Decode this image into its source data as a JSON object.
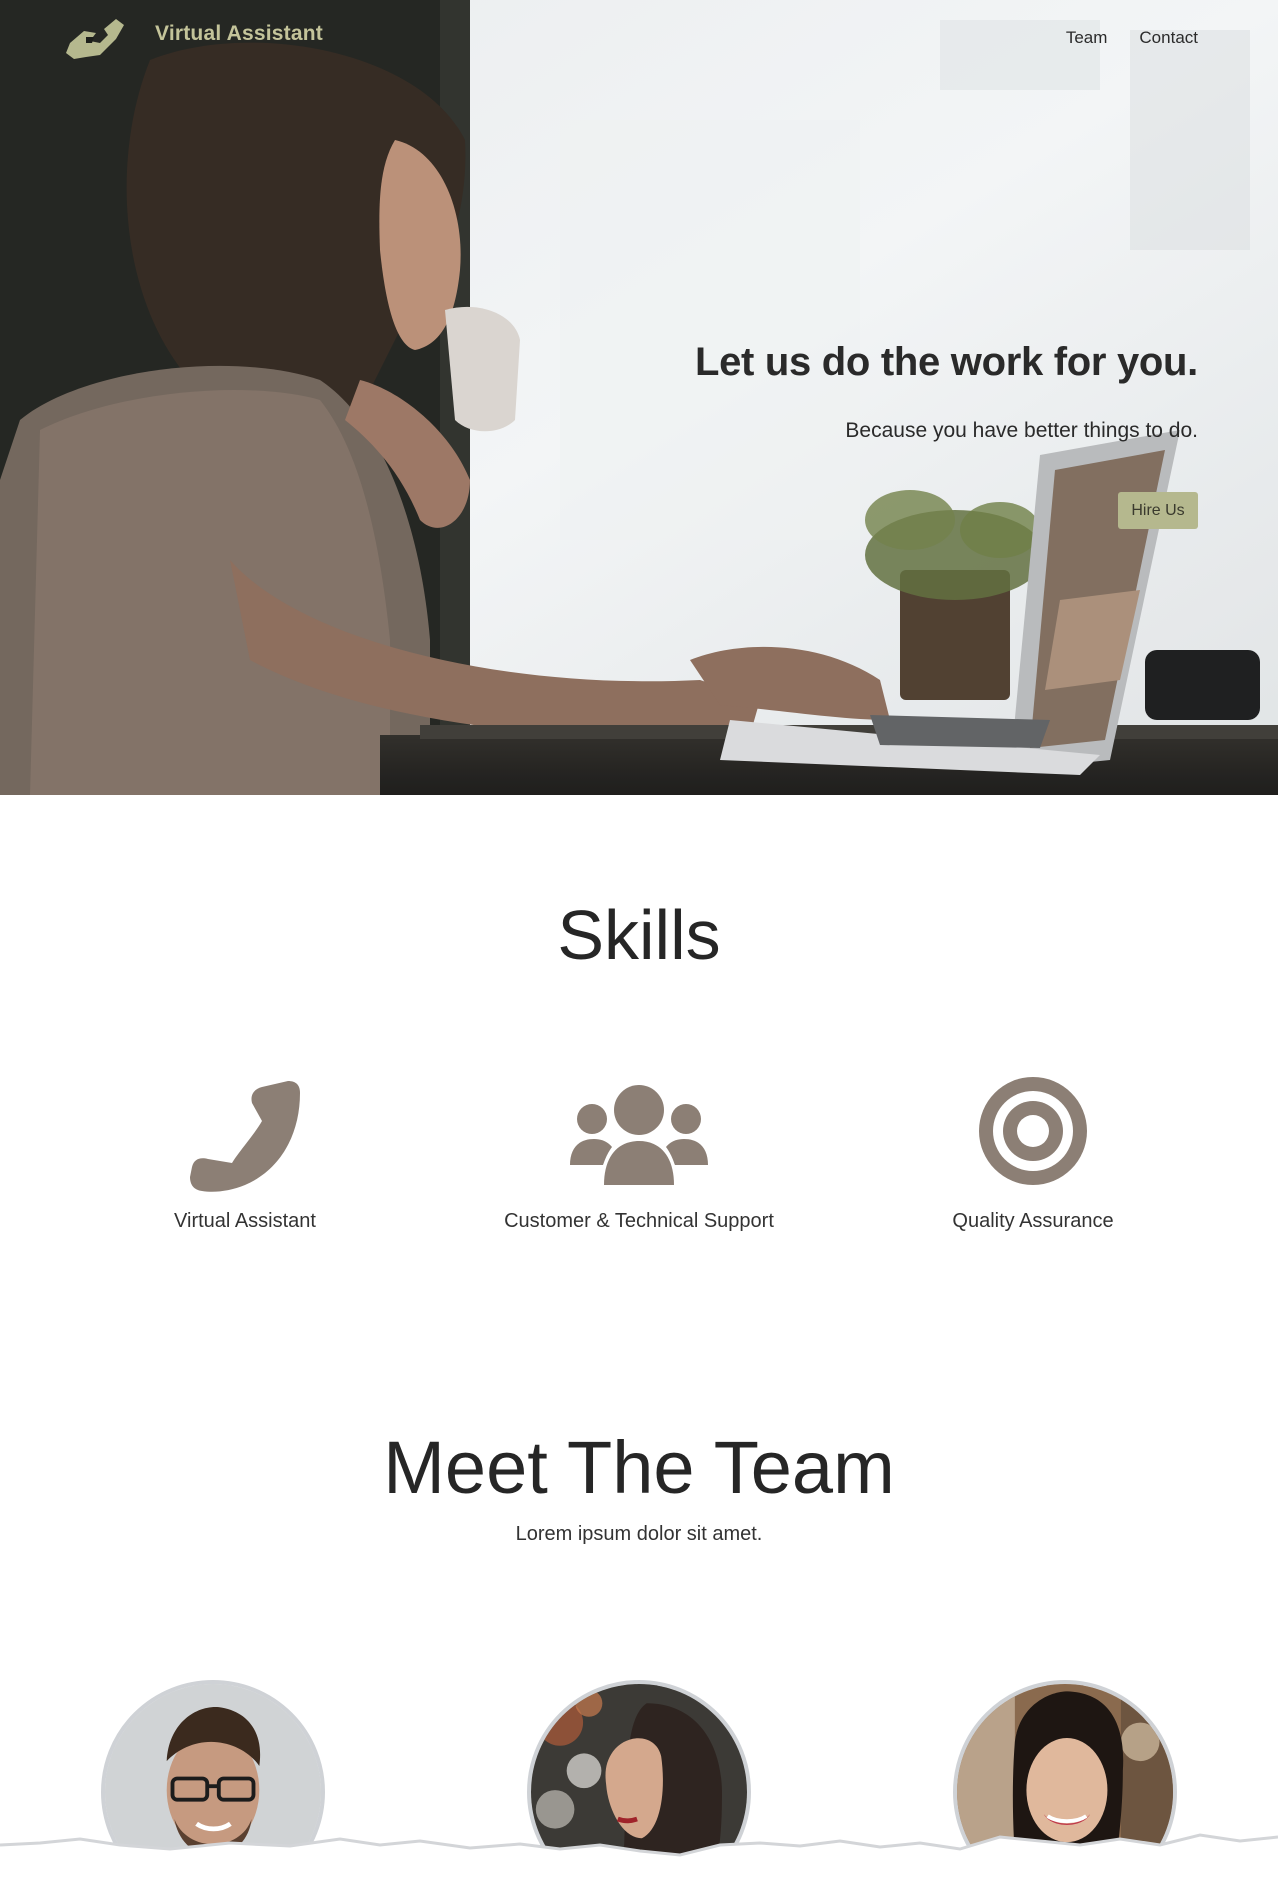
{
  "nav": {
    "brand": "Virtual Assistant",
    "links": [
      "Team",
      "Contact"
    ]
  },
  "hero": {
    "title": "Let us do the work for you.",
    "subtitle": "Because you have better things to do.",
    "cta_label": "Hire Us"
  },
  "skills": {
    "title": "Skills",
    "items": [
      {
        "label": "Virtual Assistant",
        "icon": "phone-icon"
      },
      {
        "label": "Customer & Technical Support",
        "icon": "users-icon"
      },
      {
        "label": "Quality Assurance",
        "icon": "target-icon"
      }
    ]
  },
  "team": {
    "title": "Meet The Team",
    "subtitle": "Lorem ipsum dolor sit amet."
  },
  "colors": {
    "accent": "#b5b88e",
    "brand_text": "#c4c49a",
    "icon": "#8c7f75"
  }
}
